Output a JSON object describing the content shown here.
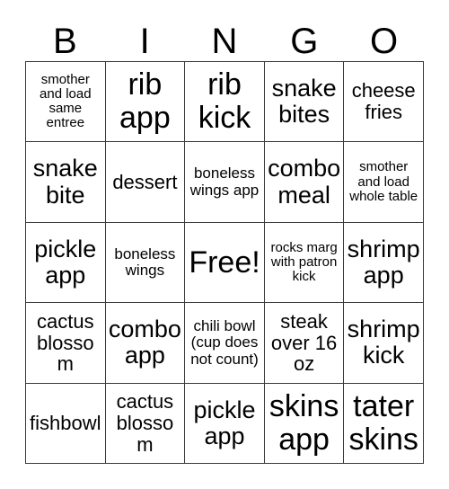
{
  "card": {
    "header_letters": [
      "B",
      "I",
      "N",
      "G",
      "O"
    ],
    "free_space_label": "Free!",
    "border_color": "#3a3a3a",
    "background_color": "#ffffff",
    "text_color": "#000000",
    "rows": [
      [
        {
          "text": "smother and load same entree",
          "size": "xs"
        },
        {
          "text": "rib app",
          "size": "xl"
        },
        {
          "text": "rib kick",
          "size": "xl"
        },
        {
          "text": "snake bites",
          "size": "lg"
        },
        {
          "text": "cheese fries",
          "size": "md"
        }
      ],
      [
        {
          "text": "snake bite",
          "size": "lg"
        },
        {
          "text": "dessert",
          "size": "md"
        },
        {
          "text": "boneless wings app",
          "size": "sm"
        },
        {
          "text": "combo meal",
          "size": "lg"
        },
        {
          "text": "smother and load whole table",
          "size": "xs"
        }
      ],
      [
        {
          "text": "pickle app",
          "size": "lg"
        },
        {
          "text": "boneless wings",
          "size": "sm"
        },
        {
          "text": "Free!",
          "size": "free"
        },
        {
          "text": "rocks marg with patron kick",
          "size": "xs"
        },
        {
          "text": "shrimp app",
          "size": "lg"
        }
      ],
      [
        {
          "text": "cactus blossom",
          "size": "md"
        },
        {
          "text": "combo app",
          "size": "lg"
        },
        {
          "text": "chili bowl (cup does not count)",
          "size": "sm"
        },
        {
          "text": "steak over 16 oz",
          "size": "md"
        },
        {
          "text": "shrimp kick",
          "size": "lg"
        }
      ],
      [
        {
          "text": "fishbowl",
          "size": "md"
        },
        {
          "text": "cactus blossom",
          "size": "md"
        },
        {
          "text": "pickle app",
          "size": "lg"
        },
        {
          "text": "skins app",
          "size": "xl"
        },
        {
          "text": "tater skins",
          "size": "xl"
        }
      ]
    ]
  }
}
